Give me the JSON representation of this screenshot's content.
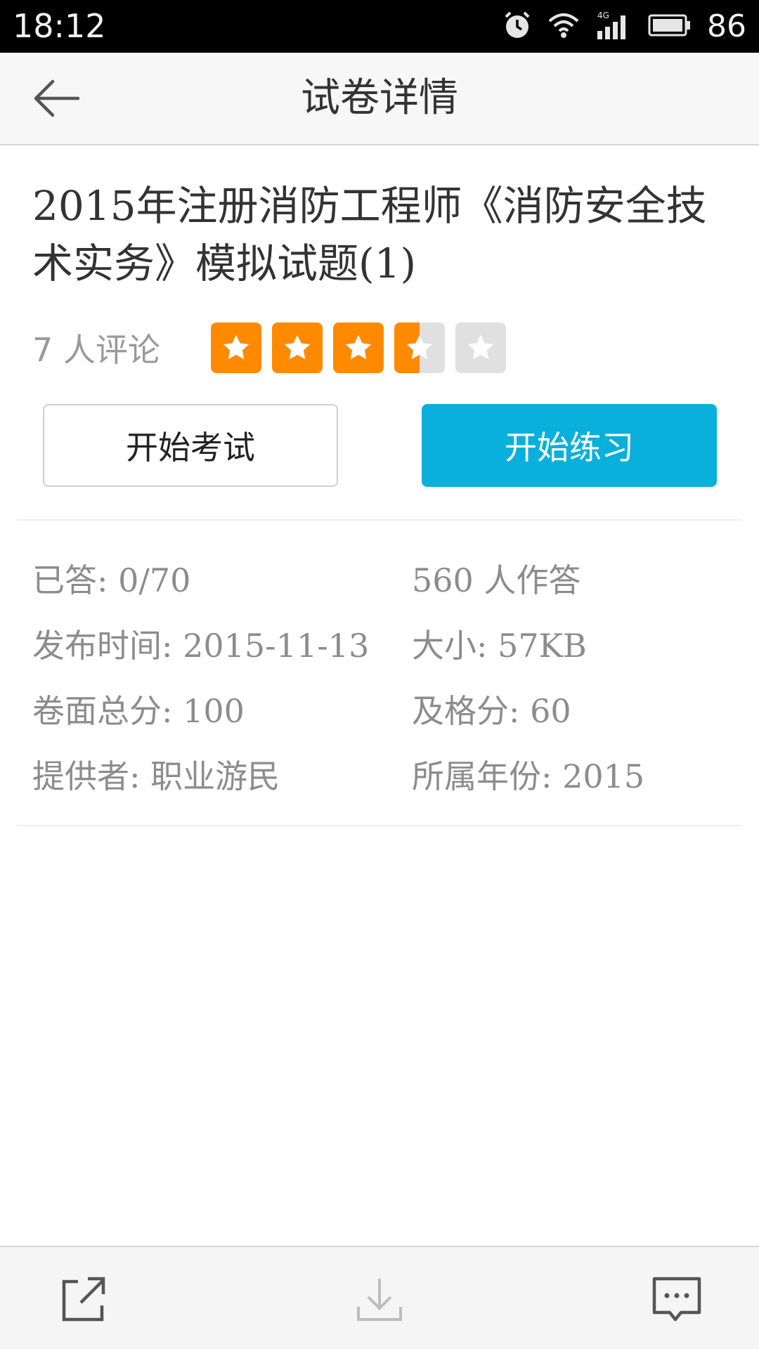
{
  "status_bar": {
    "time": "18:12",
    "battery": "86",
    "icons": [
      "alarm-icon",
      "wifi-icon",
      "signal-4g-icon",
      "battery-icon"
    ]
  },
  "header": {
    "title": "试卷详情",
    "back_icon": "arrow-left-icon"
  },
  "paper": {
    "title": "2015年注册消防工程师《消防安全技术实务》模拟试题(1)",
    "review_count": "7 人评论",
    "rating": 3.5,
    "rating_max": 5
  },
  "buttons": {
    "exam": "开始考试",
    "practice": "开始练习"
  },
  "info": {
    "answered": "已答: 0/70",
    "participants": "560 人作答",
    "publish_time": "发布时间: 2015-11-13",
    "size": "大小: 57KB",
    "total_score": "卷面总分: 100",
    "pass_score": "及格分: 60",
    "provider": "提供者: 职业游民",
    "year": "所属年份: 2015"
  },
  "colors": {
    "star_active": "#ff8a00",
    "star_inactive": "#e0e0e0",
    "primary": "#0ab0dc"
  },
  "bottom_bar": {
    "icons": [
      "share-icon",
      "download-icon",
      "comment-icon"
    ]
  }
}
